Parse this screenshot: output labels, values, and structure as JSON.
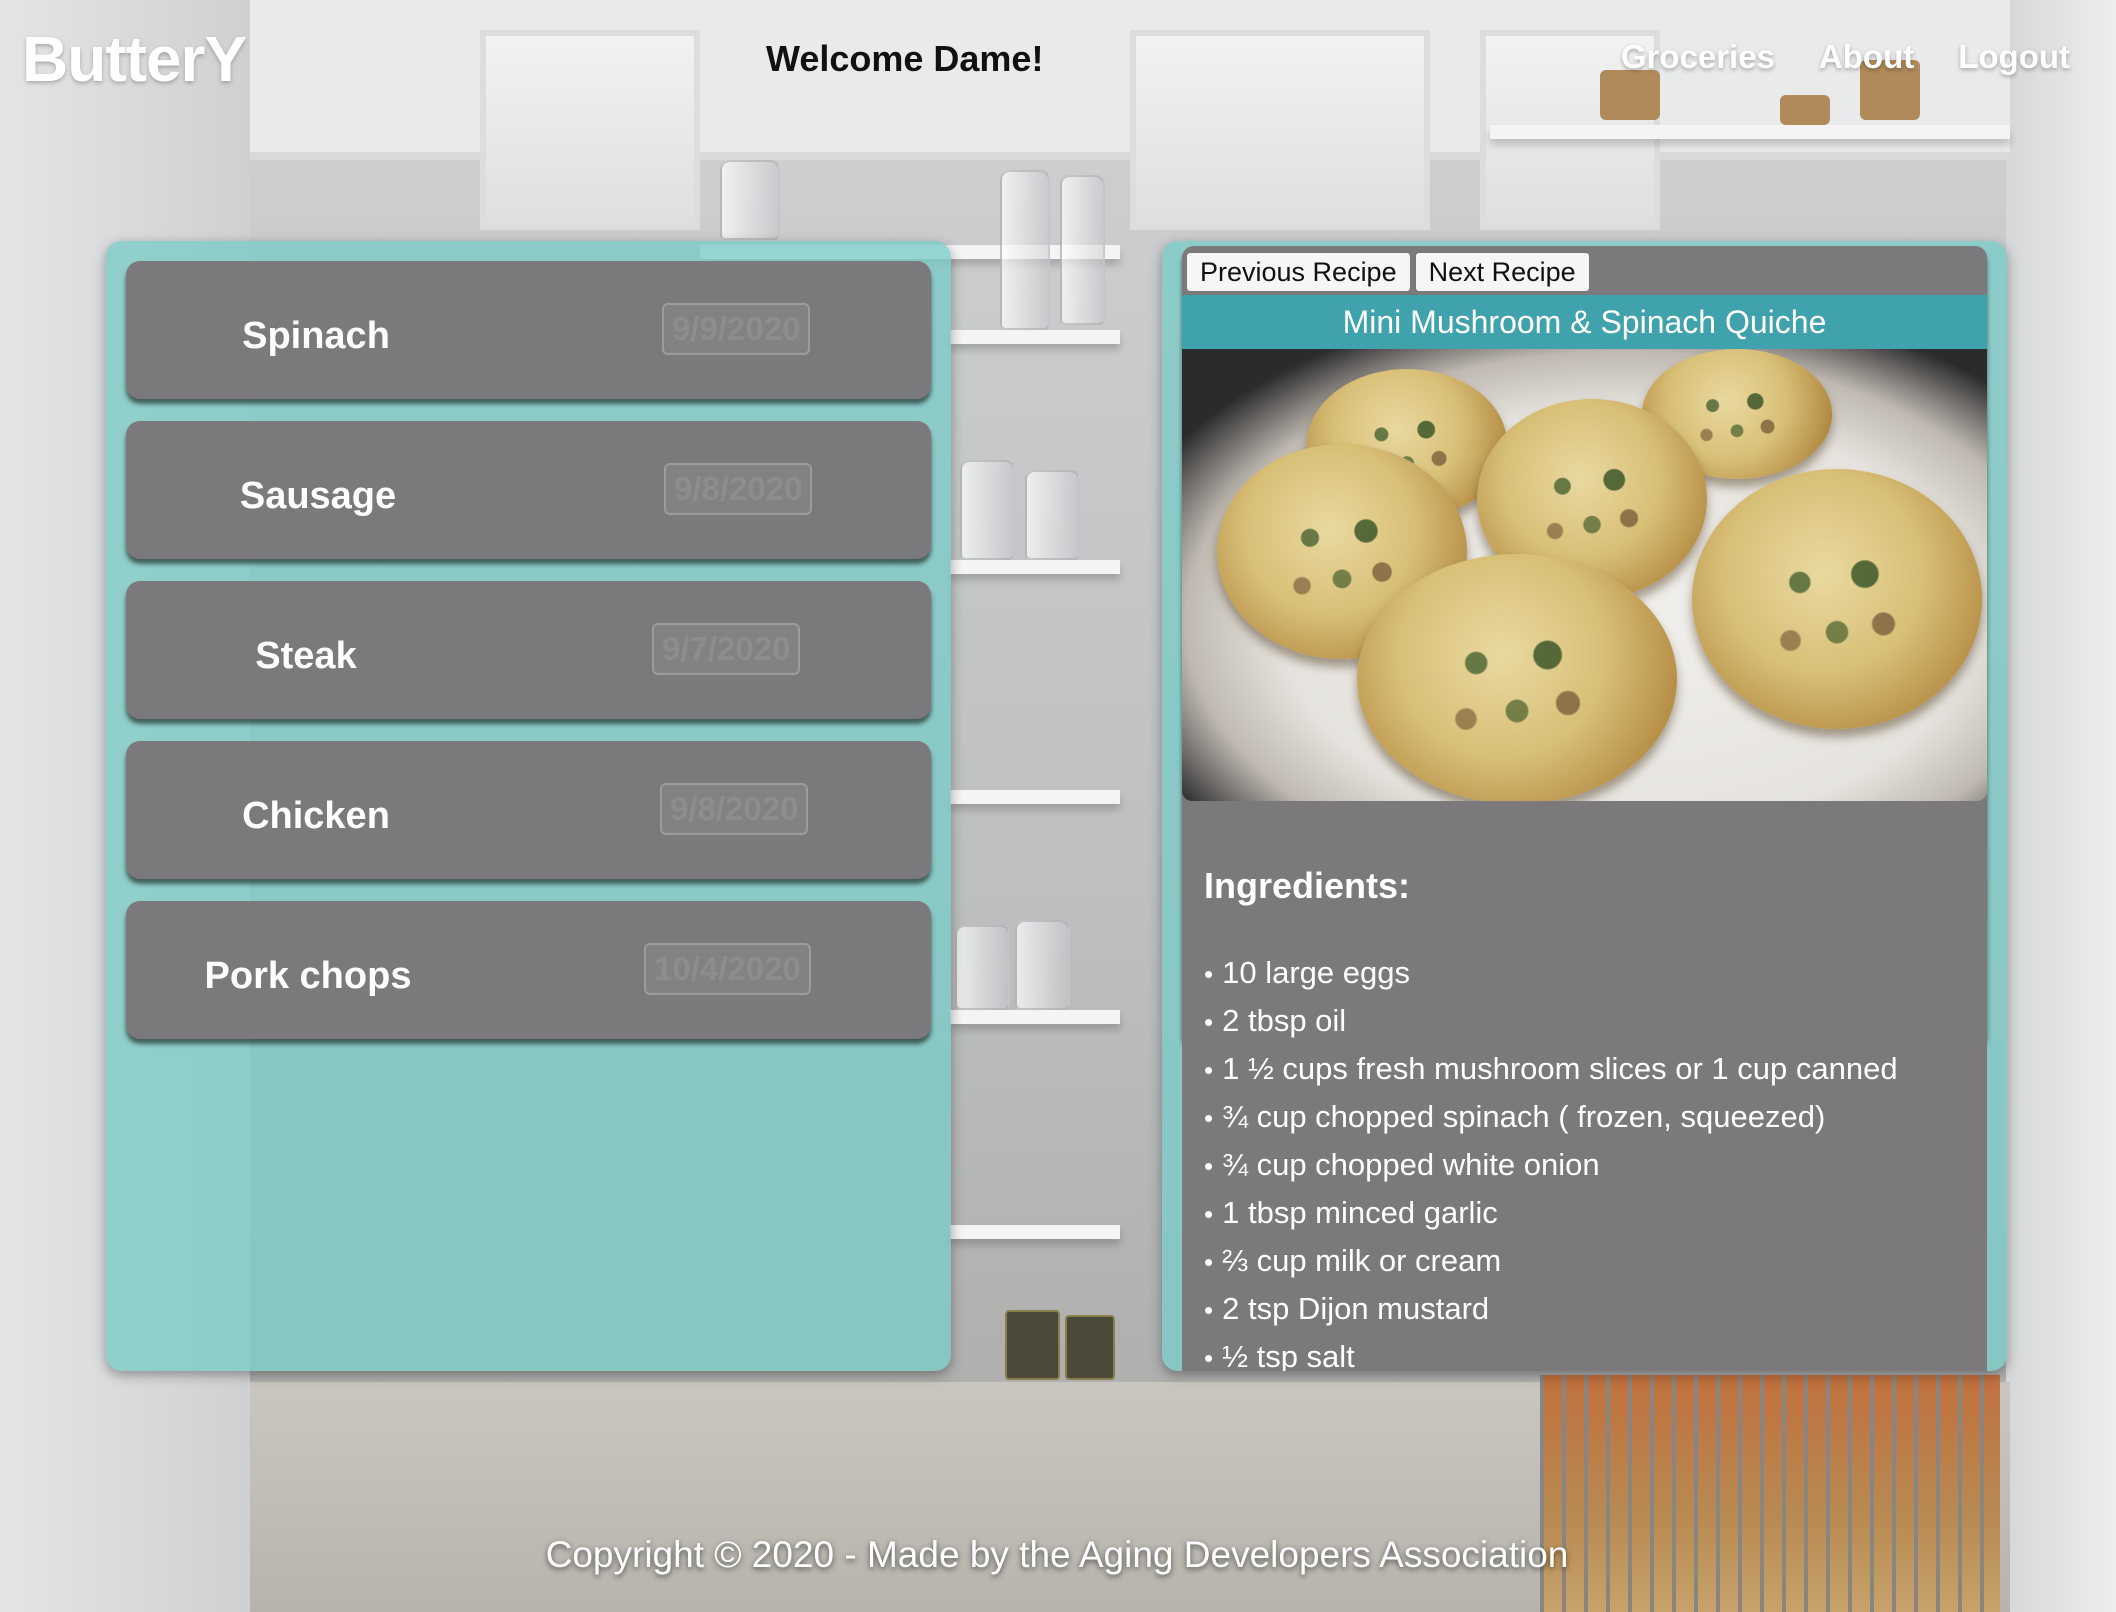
{
  "header": {
    "logo": "ButterY",
    "welcome": "Welcome Dame!",
    "nav": [
      "Groceries",
      "About",
      "Logout"
    ]
  },
  "groceries": [
    {
      "name": "Spinach",
      "date": "9/9/2020"
    },
    {
      "name": "Sausage",
      "date": "9/8/2020"
    },
    {
      "name": "Steak",
      "date": "9/7/2020"
    },
    {
      "name": "Chicken",
      "date": "9/8/2020"
    },
    {
      "name": "Pork chops",
      "date": "10/4/2020"
    }
  ],
  "recipe": {
    "prev_label": "Previous Recipe",
    "next_label": "Next Recipe",
    "title": "Mini Mushroom & Spinach Quiche",
    "ingredients_heading": "Ingredients:",
    "ingredients": [
      "10 large eggs",
      "2 tbsp oil",
      "1 ½ cups fresh mushroom slices or 1 cup canned",
      "¾ cup chopped spinach ( frozen, squeezed)",
      "¾ cup chopped white onion",
      "1 tbsp minced garlic",
      "⅔ cup milk or cream",
      "2 tsp Dijon mustard",
      "½ tsp salt"
    ]
  },
  "footer": {
    "text": "Copyright © 2020 - Made by the Aging Developers Association"
  },
  "colors": {
    "panel": "#7bccc6",
    "card": "#7b797b",
    "title_bar": "#3fa2ac"
  }
}
